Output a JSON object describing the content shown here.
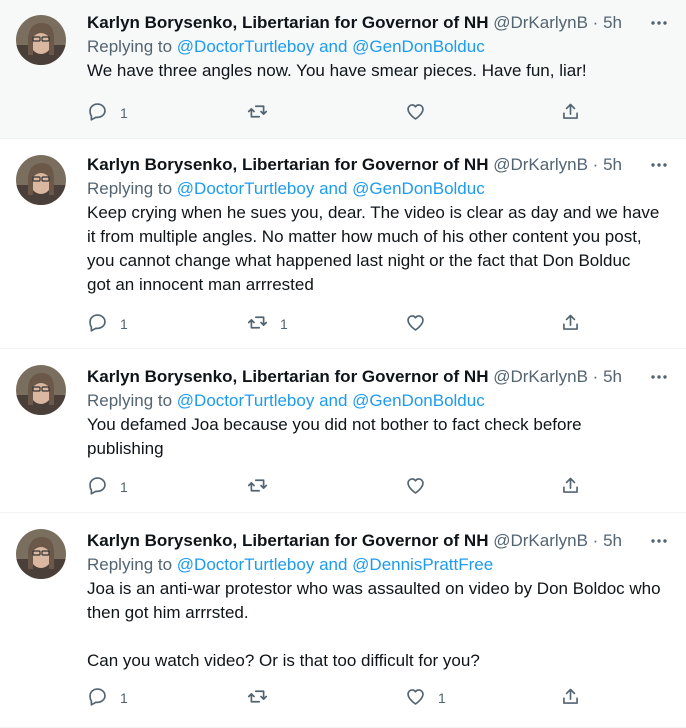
{
  "colors": {
    "accent": "#1d9bf0",
    "text": "#0f1419",
    "muted": "#536471",
    "highlight_bg": "#f7f9f9"
  },
  "tweets": [
    {
      "name": "Karlyn Borysenko, Libertarian for Governor of NH",
      "handle": "@DrKarlynB",
      "dot": "·",
      "time": "5h",
      "replying_prefix": "Replying to ",
      "mention1": "@DoctorTurtleboy",
      "and": " and ",
      "mention2": "@GenDonBolduc",
      "text": "We have three angles now. You have smear pieces. Have fun, liar!",
      "reply_count": "1",
      "retweet_count": "",
      "like_count": "",
      "icons": [
        "more-icon",
        "reply-icon",
        "retweet-icon",
        "like-icon",
        "share-icon"
      ]
    },
    {
      "name": "Karlyn Borysenko, Libertarian for Governor of NH",
      "handle": "@DrKarlynB",
      "dot": "·",
      "time": "5h",
      "replying_prefix": "Replying to ",
      "mention1": "@DoctorTurtleboy",
      "and": " and ",
      "mention2": "@GenDonBolduc",
      "text": "Keep crying when he sues you, dear. The video is clear as day and we have\nit from multiple angles. No matter how much of his other content you post,\nyou cannot change what happened last night or the fact that Don Bolduc\ngot an innocent man arrrested",
      "reply_count": "1",
      "retweet_count": "1",
      "like_count": ""
    },
    {
      "name": "Karlyn Borysenko, Libertarian for Governor of NH",
      "handle": "@DrKarlynB",
      "dot": "·",
      "time": "5h",
      "replying_prefix": "Replying to ",
      "mention1": "@DoctorTurtleboy",
      "and": " and ",
      "mention2": "@GenDonBolduc",
      "text": "You defamed Joa because you did not bother to fact check before\npublishing",
      "reply_count": "1",
      "retweet_count": "",
      "like_count": ""
    },
    {
      "name": "Karlyn Borysenko, Libertarian for Governor of NH",
      "handle": "@DrKarlynB",
      "dot": "·",
      "time": "5h",
      "replying_prefix": "Replying to ",
      "mention1": "@DoctorTurtleboy",
      "and": " and ",
      "mention2": "@DennisPrattFree",
      "text": "Joa is an anti-war protestor who was assaulted on video by Don Boldoc who\nthen got him arrrsted.\n\nCan you watch video? Or is that too difficult for you?",
      "reply_count": "1",
      "retweet_count": "",
      "like_count": "1"
    }
  ]
}
